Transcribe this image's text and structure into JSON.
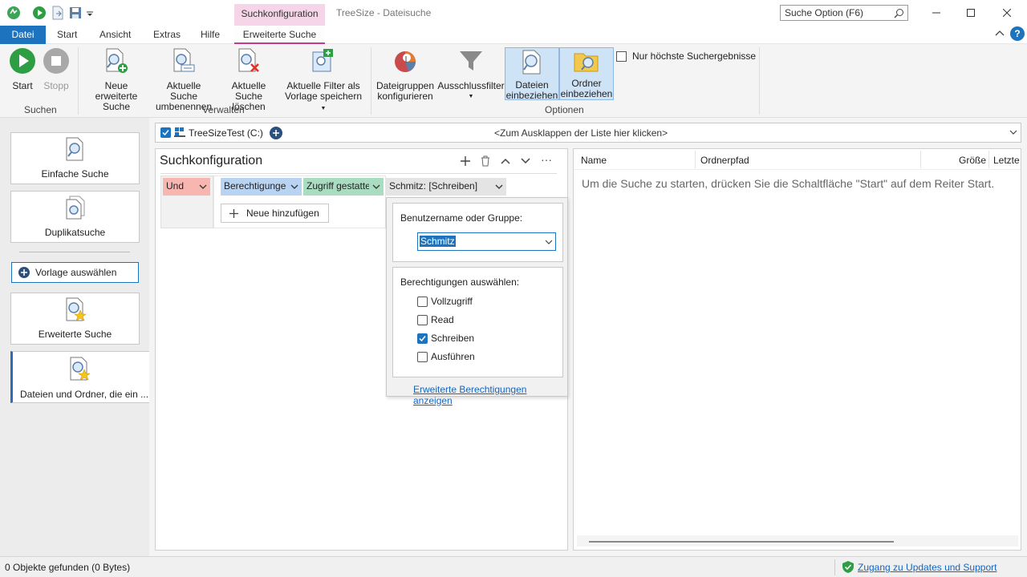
{
  "window": {
    "title": "TreeSize - Dateisuche",
    "context_tab": "Suchkonfiguration",
    "search_placeholder": "Suche Option (F6)"
  },
  "tabs": [
    "Datei",
    "Start",
    "Ansicht",
    "Extras",
    "Hilfe",
    "Erweiterte Suche"
  ],
  "ribbon": {
    "suchen": {
      "label": "Suchen",
      "start": "Start",
      "stopp": "Stopp"
    },
    "verwalten": {
      "label": "Verwalten",
      "neue_l1": "Neue erweiterte",
      "neue_l2": "Suche",
      "umb_l1": "Aktuelle Suche",
      "umb_l2": "umbenennen",
      "del_l1": "Aktuelle Suche",
      "del_l2": "löschen",
      "filt_l1": "Aktuelle Filter als",
      "filt_l2": "Vorlage speichern"
    },
    "optionen": {
      "label": "Optionen",
      "dg_l1": "Dateigruppen",
      "dg_l2": "konfigurieren",
      "ausschluss": "Ausschlussfilter",
      "dat_l1": "Dateien",
      "dat_l2": "einbeziehen",
      "ord_l1": "Ordner",
      "ord_l2": "einbeziehen",
      "nur_hoechste": "Nur höchste Suchergebnisse"
    }
  },
  "sidebar": {
    "einfache": "Einfache Suche",
    "duplikat": "Duplikatsuche",
    "vorlage": "Vorlage auswählen",
    "erweitert": "Erweiterte Suche",
    "dateien_ordner": "Dateien und Ordner, die ein ..."
  },
  "drive": {
    "name": "TreeSizeTest (C:)",
    "expand_hint": "<Zum Ausklappen der Liste hier klicken>"
  },
  "config": {
    "title": "Suchkonfiguration",
    "und": "Und",
    "berechtigungen": "Berechtigunge",
    "zugriff": "Zugriff gestattet",
    "schmitz_chip": "Schmitz: [Schreiben]",
    "neue_hinzufuegen": "Neue hinzufügen"
  },
  "popup": {
    "user_label": "Benutzername oder Gruppe:",
    "user_value": "Schmitz",
    "perm_label": "Berechtigungen auswählen:",
    "perms": [
      {
        "label": "Vollzugriff",
        "checked": false
      },
      {
        "label": "Read",
        "checked": false
      },
      {
        "label": "Schreiben",
        "checked": true
      },
      {
        "label": "Ausführen",
        "checked": false
      }
    ],
    "erweiterte_link": "Erweiterte Berechtigungen anzeigen"
  },
  "results": {
    "columns": [
      "Name",
      "Ordnerpfad",
      "Größe",
      "Letzte"
    ],
    "empty_message": "Um die Suche zu starten, drücken Sie die Schaltfläche \"Start\" auf dem Reiter Start."
  },
  "status": {
    "left": "0 Objekte gefunden (0 Bytes)",
    "right_link": "Zugang zu Updates und Support"
  }
}
